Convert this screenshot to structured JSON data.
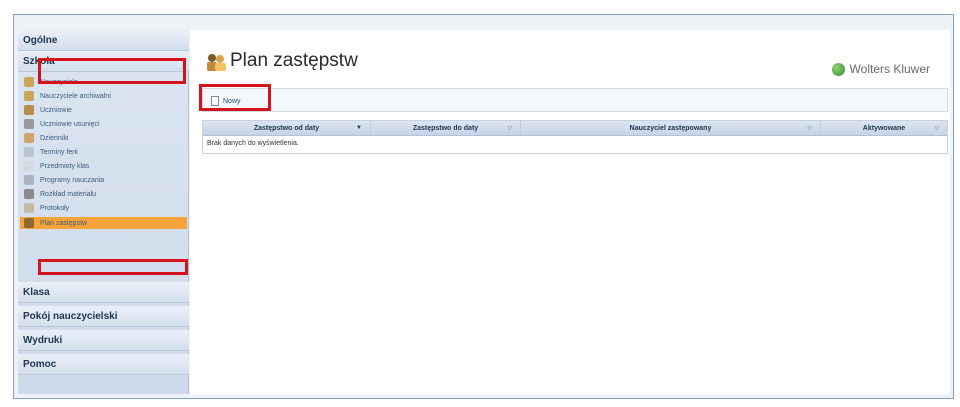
{
  "sidebar": {
    "sections": {
      "ogolne": "Ogólne",
      "szkola": "Szkoła",
      "klasa": "Klasa",
      "pokoj": "Pokój nauczycielski",
      "wydruki": "Wydruki",
      "pomoc": "Pomoc"
    },
    "items": [
      {
        "label": "Nauczyciele",
        "icon": "teachers-icon"
      },
      {
        "label": "Nauczyciele archiwalni",
        "icon": "archived-teachers-icon"
      },
      {
        "label": "Uczniowie",
        "icon": "students-icon"
      },
      {
        "label": "Uczniowie usunięci",
        "icon": "removed-students-icon"
      },
      {
        "label": "Dzienniki",
        "icon": "journals-icon"
      },
      {
        "label": "Terminy ferii",
        "icon": "calendar-icon"
      },
      {
        "label": "Przedmioty klas",
        "icon": "subjects-icon"
      },
      {
        "label": "Programy nauczania",
        "icon": "programs-icon"
      },
      {
        "label": "Rozkład materiału",
        "icon": "material-icon"
      },
      {
        "label": "Protokoły",
        "icon": "protocols-icon"
      },
      {
        "label": "Plan zastępstw",
        "icon": "substitution-plan-icon"
      }
    ]
  },
  "main": {
    "title": "Plan zastępstw",
    "brand": "Wolters Kluwer",
    "toolbar": {
      "new_label": "Nowy"
    },
    "grid": {
      "columns": [
        "Zastępstwo od daty",
        "Zastępstwo do daty",
        "Nauczyciel zastępowany",
        "Aktywowane"
      ],
      "empty_text": "Brak danych do wyświetlenia."
    }
  },
  "colors": {
    "highlight": "#d4141c",
    "selected_item": "#f6a33c"
  }
}
